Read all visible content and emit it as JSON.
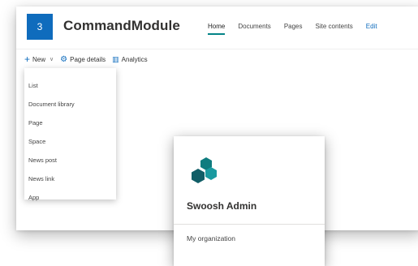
{
  "site": {
    "logo_text": "3",
    "title": "CommandModule"
  },
  "nav": {
    "items": [
      {
        "label": "Home"
      },
      {
        "label": "Documents"
      },
      {
        "label": "Pages"
      },
      {
        "label": "Site contents"
      },
      {
        "label": "Edit"
      }
    ],
    "active": "Home"
  },
  "commandbar": {
    "new_label": "New",
    "page_details_label": "Page details",
    "analytics_label": "Analytics"
  },
  "new_menu": {
    "items": [
      {
        "label": "List"
      },
      {
        "label": "Document library"
      },
      {
        "label": "Page"
      },
      {
        "label": "Space"
      },
      {
        "label": "News post"
      },
      {
        "label": "News link"
      },
      {
        "label": "App"
      }
    ]
  },
  "card": {
    "title": "Swoosh Admin",
    "subtitle": "My organization",
    "logo_icon": "hexagon-cluster-icon"
  },
  "colors": {
    "accent": "#0f6cbd",
    "teal": "#038387",
    "hex_dark": "#115e67",
    "hex_mid": "#0f7c7f",
    "hex_light": "#1a9aa0"
  }
}
